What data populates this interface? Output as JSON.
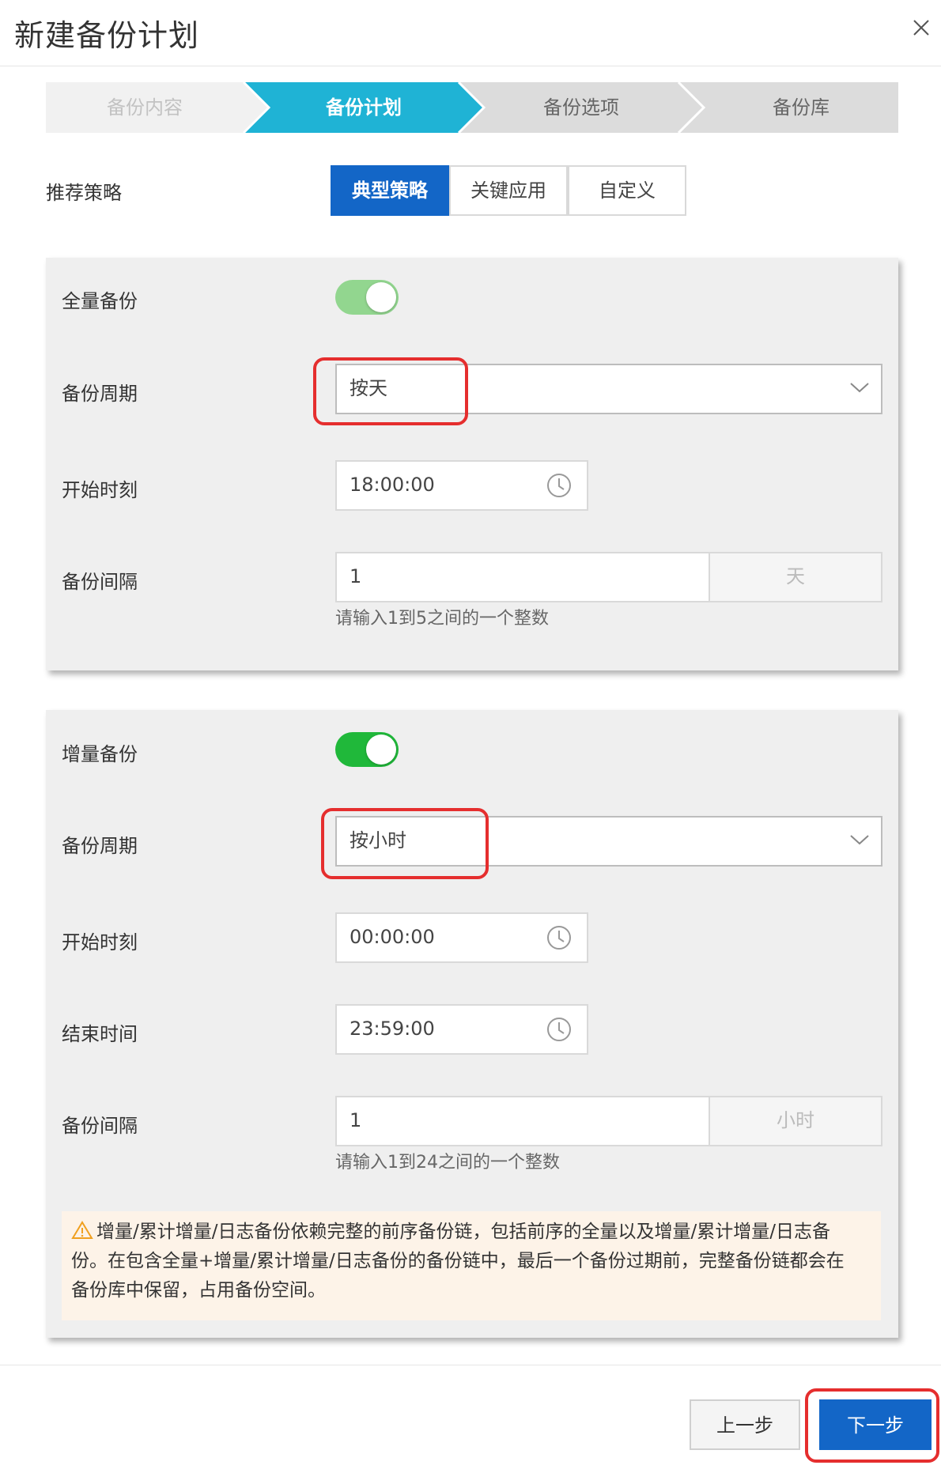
{
  "dialog": {
    "title": "新建备份计划"
  },
  "steps": [
    {
      "label": "备份内容",
      "state": "done"
    },
    {
      "label": "备份计划",
      "state": "active"
    },
    {
      "label": "备份选项",
      "state": "todo"
    },
    {
      "label": "备份库",
      "state": "todo"
    }
  ],
  "strategy": {
    "label": "推荐策略",
    "options": [
      "典型策略",
      "关键应用",
      "自定义"
    ],
    "selected": "典型策略"
  },
  "full_backup": {
    "label": "全量备份",
    "enabled": true,
    "cycle_label": "备份周期",
    "cycle_value": "按天",
    "start_label": "开始时刻",
    "start_value": "18:00:00",
    "interval_label": "备份间隔",
    "interval_value": "1",
    "interval_unit": "天",
    "interval_hint": "请输入1到5之间的一个整数"
  },
  "incremental_backup": {
    "label": "增量备份",
    "enabled": true,
    "cycle_label": "备份周期",
    "cycle_value": "按小时",
    "start_label": "开始时刻",
    "start_value": "00:00:00",
    "end_label": "结束时间",
    "end_value": "23:59:00",
    "interval_label": "备份间隔",
    "interval_value": "1",
    "interval_unit": "小时",
    "interval_hint": "请输入1到24之间的一个整数"
  },
  "notice": {
    "line1": "增量/累计增量/日志备份依赖完整的前序备份链，包括前序的全量以及增量/累计增量/日志备",
    "line2": "份。在包含全量+增量/累计增量/日志备份的备份链中，最后一个备份过期前，完整备份链都会在",
    "line3": "备份库中保留，占用备份空间。"
  },
  "buttons": {
    "prev": "上一步",
    "next": "下一步"
  },
  "colors": {
    "primary": "#1366c7",
    "step_active": "#1fb3d5",
    "toggle_on": "#20b83a",
    "toggle_on_disabled": "#92d68f",
    "highlight": "#e52e2e",
    "notice_bg": "#fdf3e8"
  }
}
